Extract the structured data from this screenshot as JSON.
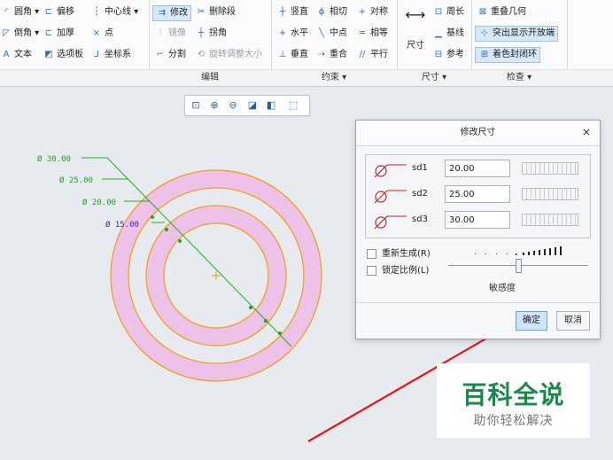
{
  "ribbon": {
    "fillet_group": {
      "fillet": "圆角",
      "chamfer": "倒角",
      "text": "文本"
    },
    "offset_group": {
      "offset": "偏移",
      "thicken": "加厚",
      "palette": "选项板"
    },
    "construct_group": {
      "centerline": "中心线",
      "point": "点",
      "csys": "坐标系"
    },
    "edit_group": {
      "modify": "修改",
      "delete_segment": "删除段",
      "mirror": "镜像",
      "corner": "拐角",
      "divide": "分割",
      "rotate_resize": "旋转调整大小",
      "label": "编辑"
    },
    "constrain_group": {
      "vertical": "竖直",
      "tangent": "相切",
      "symmetric": "对称",
      "horizontal": "水平",
      "midpoint": "中点",
      "equal": "相等",
      "perpendicular": "垂直",
      "coincident": "重合",
      "parallel": "平行",
      "label": "约束"
    },
    "dimension_group": {
      "dimension": "尺寸",
      "perimeter": "周长",
      "baseline": "基线",
      "reference": "参考",
      "label": "尺寸"
    },
    "inspect_group": {
      "overlap_geometry": "重叠几何",
      "highlight_open_ends": "突出显示开放端",
      "shade_closed_loops": "着色封闭环",
      "label": "检查"
    }
  },
  "sketch": {
    "dimensions": [
      "Ø 30.00",
      "Ø 25.00",
      "Ø 20.00",
      "Ø 15.00"
    ]
  },
  "dialog": {
    "title": "修改尺寸",
    "close": "×",
    "rows": [
      {
        "name": "sd1",
        "value": "20.00"
      },
      {
        "name": "sd2",
        "value": "25.00"
      },
      {
        "name": "sd3",
        "value": "30.00"
      }
    ],
    "regenerate": "重新生成(R)",
    "lock_scale": "锁定比例(L)",
    "sensitivity": "敏感度",
    "sensitivity_level": 0.5,
    "ok": "确定",
    "cancel": "取消"
  },
  "watermark": {
    "title": "百科全说",
    "subtitle": "助你轻松解决"
  },
  "colors": {
    "ring_fill": "#eec1e8",
    "ring_edge": "#f0a020",
    "dimension": "#21b021",
    "arrow": "#e02020",
    "accent": "#2a6fb5"
  }
}
